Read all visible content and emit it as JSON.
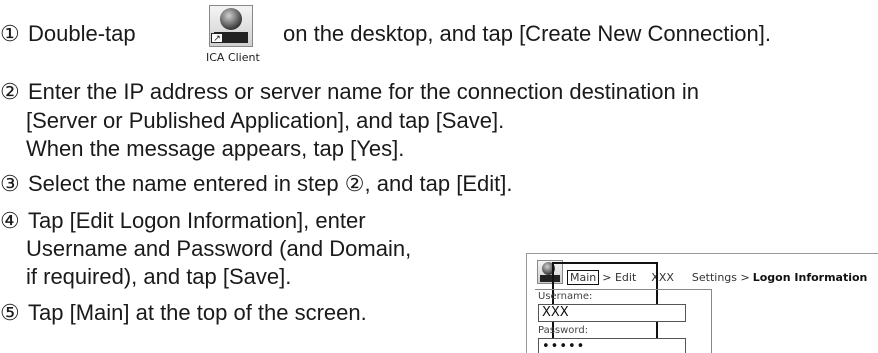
{
  "steps": [
    {
      "num": "①",
      "text_before": "Double-tap",
      "text_after": "on the desktop, and tap [Create New Connection]."
    },
    {
      "num": "②",
      "lines": [
        "Enter the IP address or server name for the connection destination in",
        "[Server or Published Application], and tap [Save].",
        "When the message appears, tap [Yes]."
      ]
    },
    {
      "num": "③",
      "text": "Select the name entered in step ②, and tap [Edit]."
    },
    {
      "num": "④",
      "lines": [
        "Tap [Edit Logon Information], enter",
        "Username and Password (and Domain,",
        "if required), and tap [Save]."
      ]
    },
    {
      "num": "⑤",
      "text": "Tap [Main] at the top of the screen."
    }
  ],
  "ica_icon": {
    "name": "ica-client-icon",
    "label": "ICA Client"
  },
  "inset": {
    "crumb_main": "Main",
    "crumb_edit": "> Edit",
    "crumb_xxx": "XXX",
    "crumb_settings": "Settings >",
    "crumb_logon": "Logon Information",
    "username_label": "Username:",
    "username_value": "XXX",
    "password_label": "Password:",
    "password_value": "•••••"
  }
}
